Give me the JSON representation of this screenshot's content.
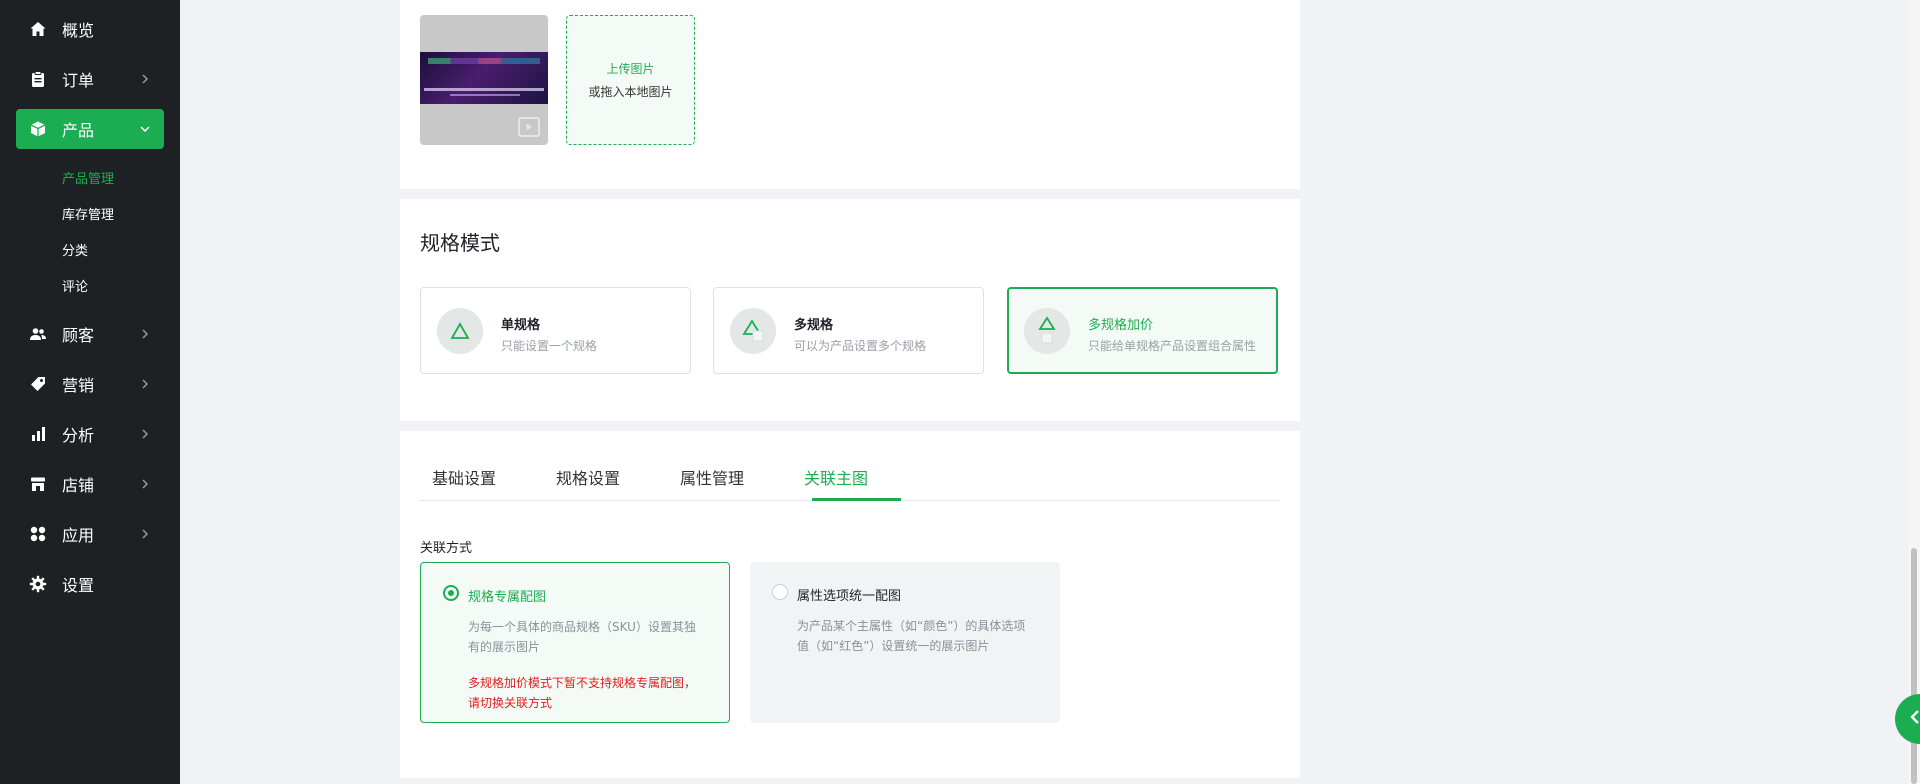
{
  "sidebar": {
    "items": [
      {
        "label": "概览",
        "icon": "home-icon"
      },
      {
        "label": "订单",
        "icon": "clipboard-icon"
      },
      {
        "label": "产品",
        "icon": "box-icon"
      },
      {
        "label": "顾客",
        "icon": "users-icon"
      },
      {
        "label": "营销",
        "icon": "tag-icon"
      },
      {
        "label": "分析",
        "icon": "bar-chart-icon"
      },
      {
        "label": "店铺",
        "icon": "store-icon"
      },
      {
        "label": "应用",
        "icon": "apps-icon"
      },
      {
        "label": "设置",
        "icon": "gear-icon"
      }
    ],
    "sub_items": [
      "产品管理",
      "库存管理",
      "分类",
      "评论"
    ],
    "accent": "#1cad53",
    "background": "#1d2124"
  },
  "media": {
    "upload_label": "上传图片",
    "upload_hint": "或拖入本地图片"
  },
  "spec_mode": {
    "title": "规格模式",
    "options": [
      {
        "title": "单规格",
        "desc": "只能设置一个规格"
      },
      {
        "title": "多规格",
        "desc": "可以为产品设置多个规格"
      },
      {
        "title": "多规格加价",
        "desc": "只能给单规格产品设置组合属性"
      }
    ]
  },
  "tabs": {
    "items": [
      "基础设置",
      "规格设置",
      "属性管理",
      "关联主图"
    ],
    "active": "关联主图"
  },
  "association": {
    "label": "关联方式",
    "options": [
      {
        "title": "规格专属配图",
        "desc": "为每一个具体的商品规格（SKU）设置其独有的展示图片",
        "warning": "多规格加价模式下暂不支持规格专属配图，请切换关联方式"
      },
      {
        "title": "属性选项统一配图",
        "desc": "为产品某个主属性（如“颜色”）的具体选项值（如“红色”）设置统一的展示图片"
      }
    ]
  }
}
